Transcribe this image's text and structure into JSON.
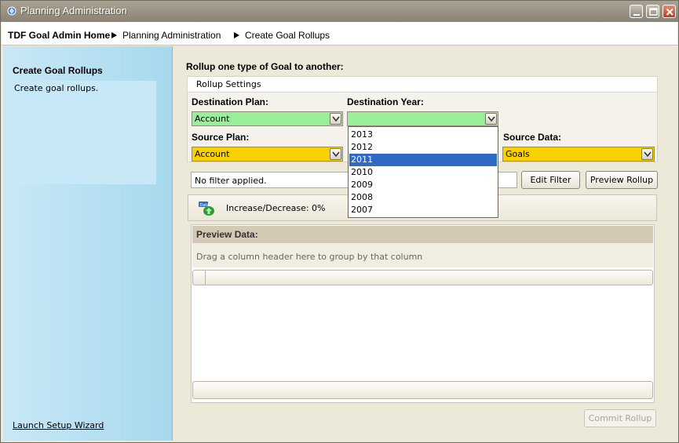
{
  "window": {
    "title": "Planning Administration"
  },
  "breadcrumb": [
    "TDF Goal Admin Home",
    "Planning Administration",
    "Create Goal Rollups"
  ],
  "sidebar": {
    "title": "Create Goal Rollups",
    "description": "Create goal rollups.",
    "wizard_link": "Launch Setup Wizard"
  },
  "main": {
    "heading": "Rollup one type of Goal to another:",
    "settings_tab": "Rollup Settings",
    "destination_plan": {
      "label": "Destination Plan:",
      "value": "Account"
    },
    "destination_year": {
      "label": "Destination Year:",
      "value": "",
      "options": [
        "2013",
        "2012",
        "2011",
        "2010",
        "2009",
        "2008",
        "2007"
      ],
      "selected": "2011"
    },
    "source_plan": {
      "label": "Source Plan:",
      "value": "Account"
    },
    "source_data": {
      "label": "Source Data:",
      "value": "Goals"
    },
    "filter_text": "No filter applied.",
    "edit_filter_button": "Edit Filter",
    "preview_rollup_button": "Preview Rollup",
    "increase_decrease": "Increase/Decrease: 0%",
    "preview_header": "Preview Data:",
    "group_hint": "Drag a column header here to group by that column",
    "commit_button": "Commit Rollup"
  },
  "colors": {
    "accent_green": "#99ee99",
    "accent_gold": "#f9d000",
    "selection": "#316ac5"
  }
}
